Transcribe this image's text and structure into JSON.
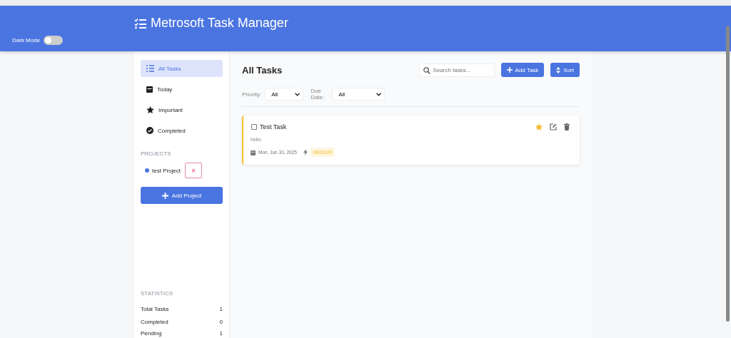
{
  "header": {
    "title": "Metrosoft Task Manager",
    "dark_mode": {
      "label": "Dark Mode",
      "on": false
    }
  },
  "sidebar": {
    "items": [
      {
        "label": "All Tasks",
        "selected": true
      },
      {
        "label": "Today",
        "selected": false
      },
      {
        "label": "Important",
        "selected": false
      },
      {
        "label": "Completed",
        "selected": false
      }
    ],
    "projects_heading": "PROJECTS",
    "projects": [
      {
        "name": "test Project",
        "color": "#4a74e0",
        "delete": "×"
      }
    ],
    "add_project": "Add Project",
    "statistics_heading": "STATISTICS",
    "statistics": [
      {
        "label": "Total Tasks",
        "value": "1"
      },
      {
        "label": "Completed",
        "value": "0"
      },
      {
        "label": "Pending",
        "value": "1"
      }
    ]
  },
  "main": {
    "title": "All Tasks",
    "search": {
      "placeholder": "Search tasks..."
    },
    "add_task": "Add Task",
    "sort": "Sort",
    "filters": [
      {
        "label": "Priority:",
        "value": "All"
      },
      {
        "label": "Due Date:",
        "value": "All"
      }
    ],
    "tasks": [
      {
        "title": "Test Task",
        "checked": false,
        "important": true,
        "description": "hello",
        "date": "Mon, Jun 30, 2025",
        "priority": "MEDIUM"
      }
    ]
  }
}
